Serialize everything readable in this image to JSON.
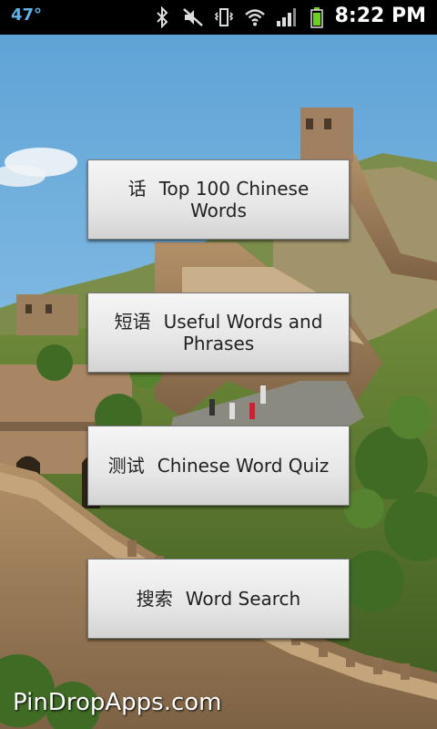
{
  "status_bar": {
    "temperature": "47°",
    "time": "8:22 PM",
    "icons": [
      "bluetooth-icon",
      "mute-icon",
      "vibrate-icon",
      "wifi-icon",
      "signal-icon",
      "battery-icon"
    ],
    "colors": {
      "temperature": "#5eb0e8",
      "battery": "#6ad21a"
    }
  },
  "menu": {
    "items": [
      {
        "hanzi": "话",
        "label": "Top 100 Chinese Words"
      },
      {
        "hanzi": "短语",
        "label": "Useful Words and Phrases"
      },
      {
        "hanzi": "测试",
        "label": "Chinese Word Quiz"
      },
      {
        "hanzi": "搜索",
        "label": "Word Search"
      }
    ]
  },
  "branding": {
    "watermark": "PinDropApps.com"
  }
}
